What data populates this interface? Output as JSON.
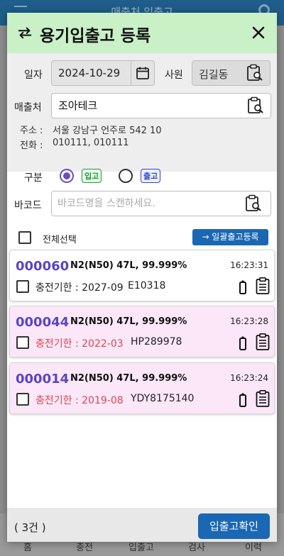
{
  "background_app": {
    "title": "매출처 입출고",
    "tabs": [
      "홈",
      "충전",
      "입출고",
      "검사",
      "이력"
    ]
  },
  "dialog": {
    "title": "용기입출고 등록"
  },
  "form": {
    "date_label": "일자",
    "date_value": "2024-10-29",
    "employee_label": "사원",
    "employee_value": "김길동",
    "customer_label": "매출처",
    "customer_value": "조아테크",
    "address_label": "주소 :",
    "address_value": "서울 강남구 언주로 542 10",
    "phone_label": "전화 :",
    "phone_value": "010111, 010111",
    "type_label": "구분",
    "type_options": [
      {
        "label": "입고",
        "selected": true
      },
      {
        "label": "출고",
        "selected": false
      }
    ],
    "barcode_label": "바코드",
    "barcode_placeholder": "바코드명을 스캔하세요."
  },
  "list": {
    "select_all_label": "전체선택",
    "bulk_button_label": "→ 일괄출고등록",
    "items": [
      {
        "code": "000060",
        "gas": "N2(N50) 47L, 99.999%",
        "time": "16:23:31",
        "expiry": "충전기한 : 2027-09",
        "serial": "E10318",
        "expired": false
      },
      {
        "code": "000044",
        "gas": "N2(N50) 47L, 99.999%",
        "time": "16:23:28",
        "expiry": "충전기한 : 2022-03",
        "serial": "HP289978",
        "expired": true
      },
      {
        "code": "000014",
        "gas": "N2(N50) 47L, 99.999%",
        "time": "16:23:24",
        "expiry": "충전기한 : 2019-08",
        "serial": "YDY8175140",
        "expired": true
      }
    ]
  },
  "footer": {
    "count": "( 3건 )",
    "confirm_label": "입출고확인"
  },
  "colors": {
    "header_bg": "#c9f0c7",
    "accent_blue": "#1a67b4",
    "code_purple": "#5a44c7",
    "expired_card_bg": "#fbe7f8",
    "warning_red": "#d9464f"
  }
}
